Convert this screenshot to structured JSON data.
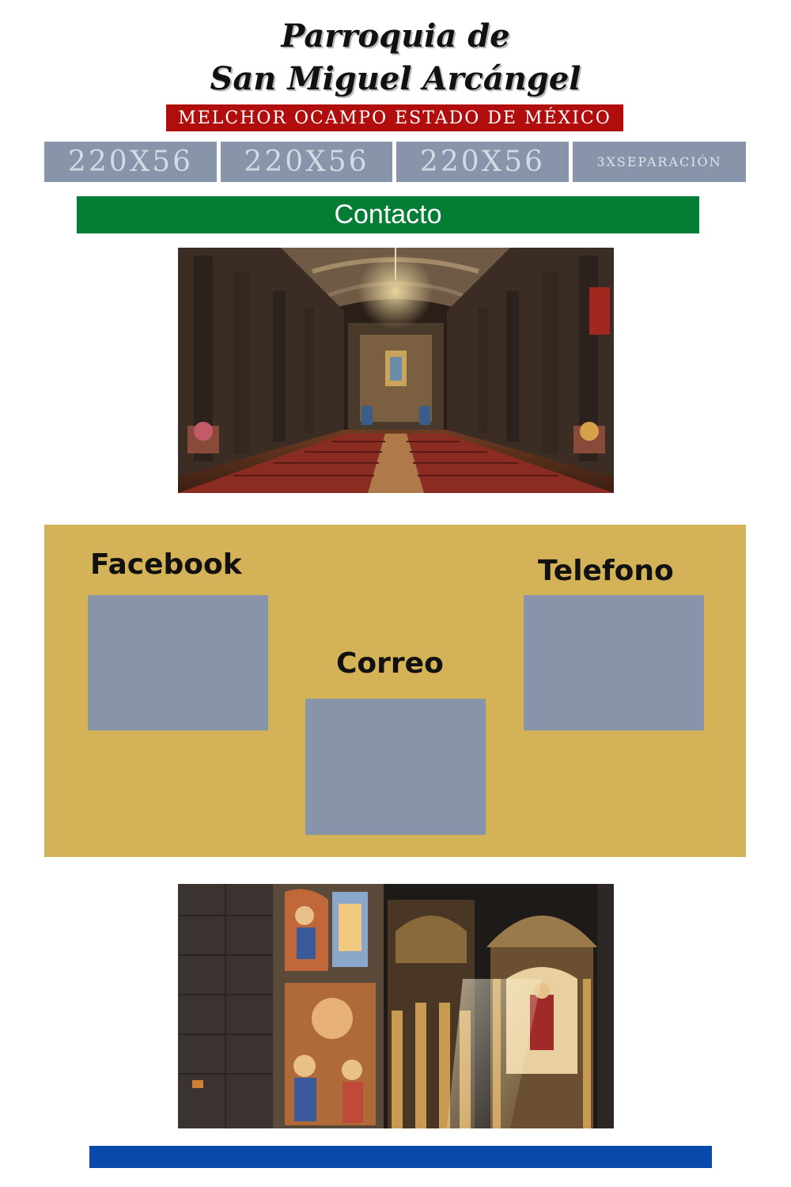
{
  "header": {
    "title_line1": "Parroquia de",
    "title_line2": "San Miguel Arcángel",
    "subtitle": "MELCHOR OCAMPO ESTADO DE MÉXICO"
  },
  "nav": {
    "buttons": [
      "220X56",
      "220X56",
      "220X56",
      "3XSEPARACIÓN"
    ]
  },
  "contact": {
    "label": "Contacto"
  },
  "contact_panel": {
    "facebook_label": "Facebook",
    "correo_label": "Correo",
    "telefono_label": "Telefono"
  },
  "colors": {
    "subtitle_bg": "#b20d0d",
    "nav_bg": "#8794a9",
    "contact_bg": "#067d34",
    "panel_bg": "#d4b258",
    "footer_bg": "#0949ac"
  }
}
